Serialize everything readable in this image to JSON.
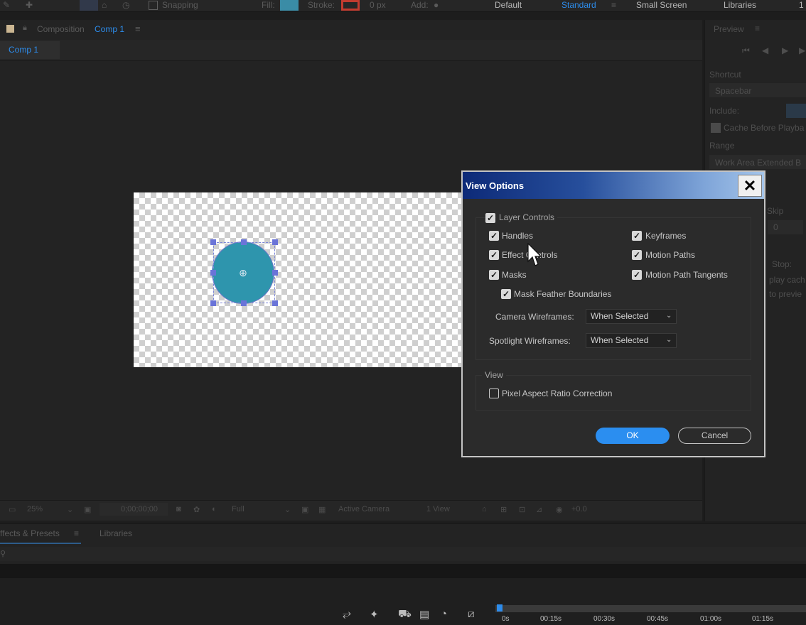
{
  "toolbar": {
    "snapping_label": "Snapping",
    "fill_label": "Fill:",
    "stroke_label": "Stroke:",
    "stroke_width": "0 px",
    "add_label": "Add:",
    "workspaces": [
      "Default",
      "Standard",
      "Small Screen",
      "Libraries",
      "1"
    ],
    "active_workspace": "Standard",
    "fill_color": "#3a8ca6",
    "stroke_color": "#c23b2f"
  },
  "composition": {
    "header_prefix": "Composition",
    "header_name": "Comp 1",
    "tab_label": "Comp 1",
    "footer": {
      "zoom": "25%",
      "timecode": "0;00;00;00",
      "resolution": "Full",
      "camera": "Active Camera",
      "views": "1 View",
      "exposure": "+0.0"
    }
  },
  "preview": {
    "title": "Preview",
    "shortcut_label": "Shortcut",
    "shortcut_value": "Spacebar",
    "include_label": "Include:",
    "cache_label": "Cache Before Playba",
    "range_label": "Range",
    "range_value": "Work Area Extended B",
    "skip_label": "Skip",
    "skip_value": "0",
    "stop_label": "Stop:",
    "stop_line2": "play cach",
    "stop_line3": "to previe"
  },
  "effects_panel": {
    "tabs": [
      "ffects & Presets",
      "Libraries"
    ]
  },
  "timeline": {
    "ticks": [
      "0s",
      "00:15s",
      "00:30s",
      "00:45s",
      "01:00s",
      "01:15s"
    ]
  },
  "dialog": {
    "title": "View Options",
    "close_glyph": "✕",
    "layer_controls": {
      "label": "Layer Controls",
      "checked": true,
      "left_options": [
        {
          "label": "Handles",
          "checked": true
        },
        {
          "label": "Effect Controls",
          "checked": true
        },
        {
          "label": "Masks",
          "checked": true
        }
      ],
      "right_options": [
        {
          "label": "Keyframes",
          "checked": true
        },
        {
          "label": "Motion Paths",
          "checked": true
        },
        {
          "label": "Motion Path Tangents",
          "checked": true
        }
      ],
      "mask_feather": {
        "label": "Mask Feather Boundaries",
        "checked": true
      },
      "camera_wireframes_label": "Camera Wireframes:",
      "camera_wireframes_value": "When Selected",
      "spotlight_wireframes_label": "Spotlight Wireframes:",
      "spotlight_wireframes_value": "When Selected"
    },
    "view": {
      "legend": "View",
      "pixel_aspect_label": "Pixel Aspect Ratio Correction",
      "pixel_aspect_checked": false
    },
    "ok_label": "OK",
    "cancel_label": "Cancel"
  }
}
